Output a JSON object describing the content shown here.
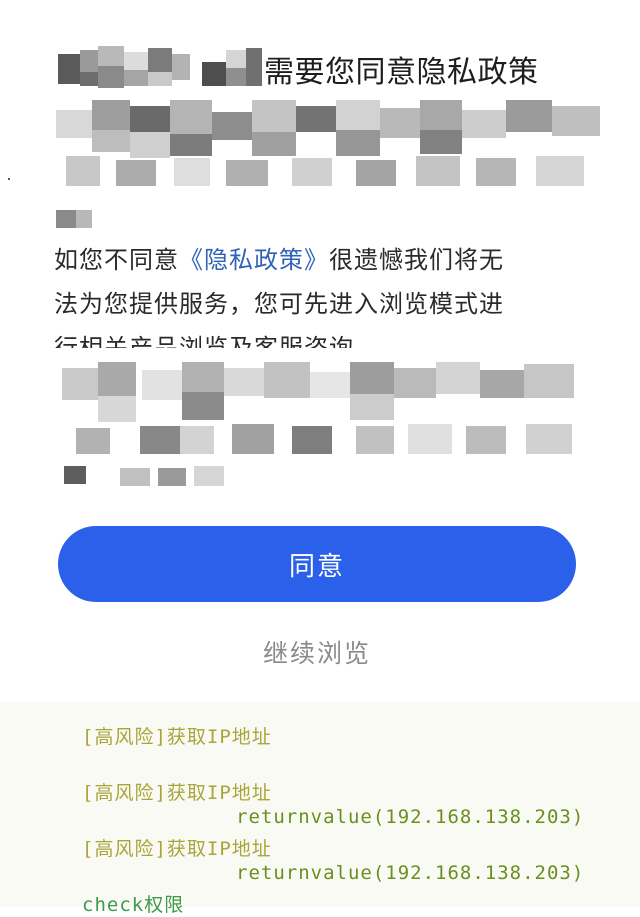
{
  "dialog": {
    "title": "需要您同意隐私政策",
    "body_lines": [
      "如您不同意",
      "《隐私政策》",
      "很遗憾我们将无",
      "法为您提供服务，您可先进入浏览模式进",
      "行相关产品浏览及客服咨询。"
    ],
    "agree_label": "同意",
    "continue_label": "继续浏览"
  },
  "log": {
    "entries": [
      {
        "risk": "[高风险]获取IP地址",
        "return": ""
      },
      {
        "risk": "[高风险]获取IP地址",
        "return": "returnvalue(192.168.138.203)"
      },
      {
        "risk": "[高风险]获取IP地址",
        "return": "returnvalue(192.168.138.203)"
      }
    ],
    "check": "check权限"
  },
  "colors": {
    "button": "#2a60ea",
    "link": "#2f63b8",
    "risk_text": "#a9a53a",
    "return_text": "#6a8f1f",
    "check_text": "#3f9a48"
  }
}
